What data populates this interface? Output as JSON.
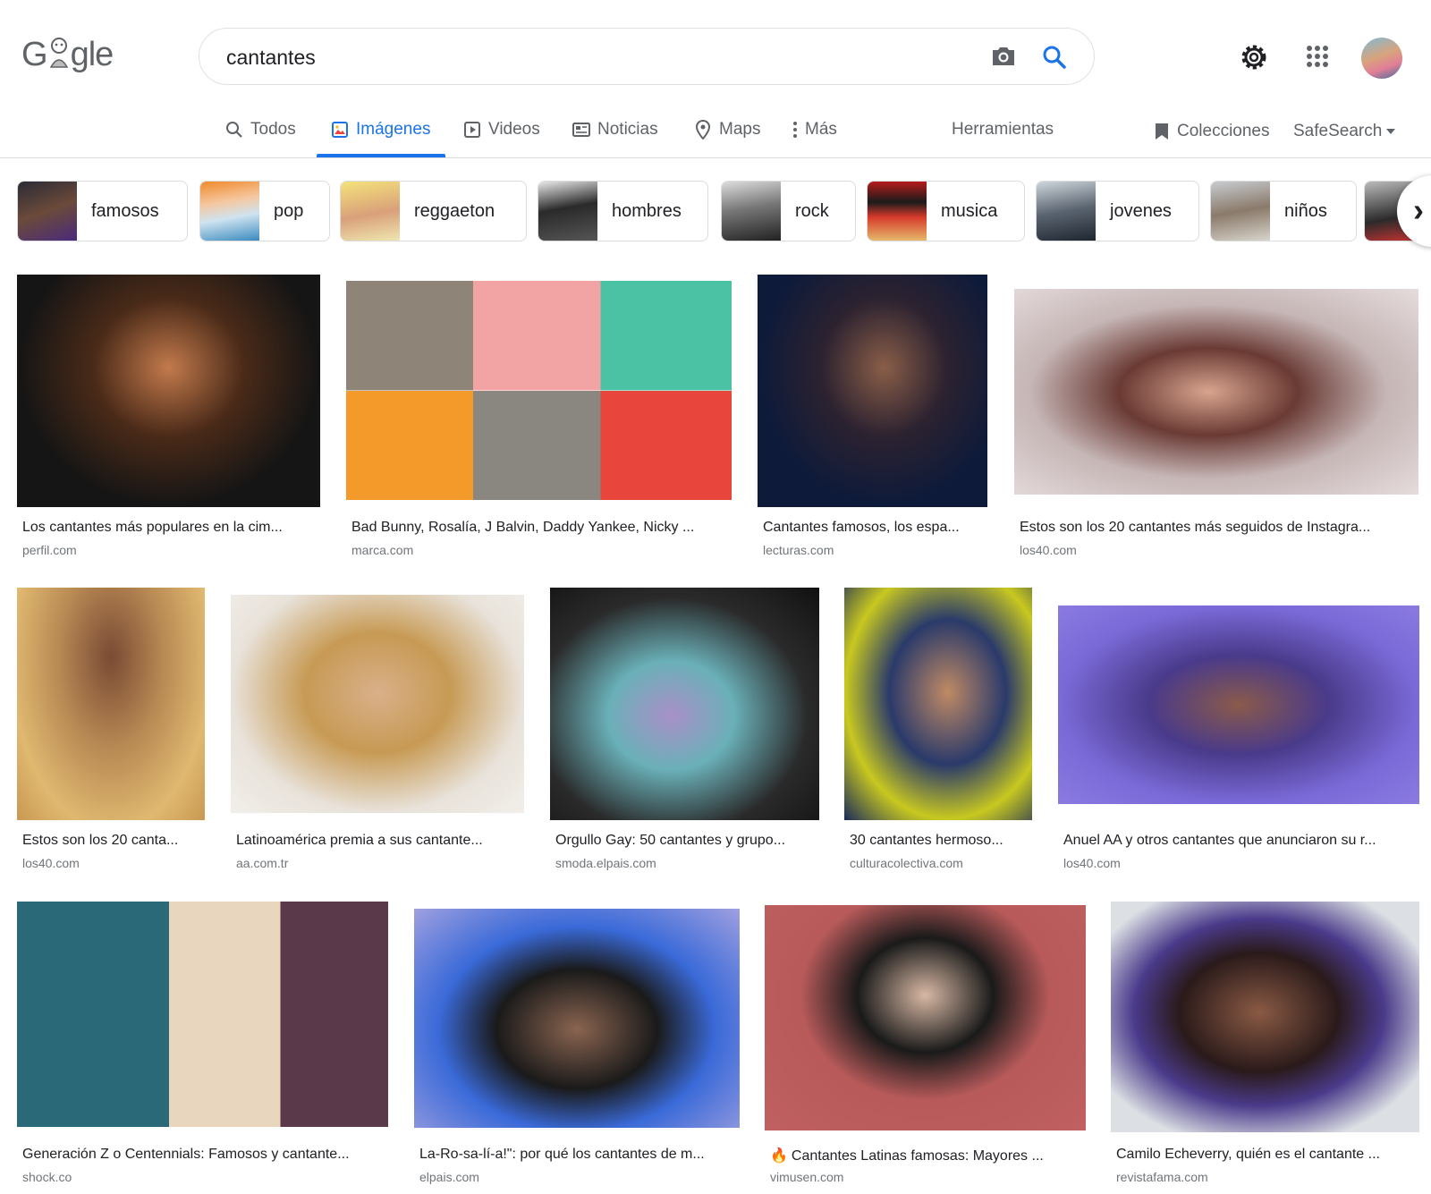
{
  "header": {
    "logo_text": "Gogle",
    "search_value": "cantantes"
  },
  "tabs": [
    {
      "label": "Todos",
      "icon": "search-icon"
    },
    {
      "label": "Imágenes",
      "icon": "image-icon",
      "active": true
    },
    {
      "label": "Videos",
      "icon": "play-icon"
    },
    {
      "label": "Noticias",
      "icon": "news-icon"
    },
    {
      "label": "Maps",
      "icon": "map-pin-icon"
    },
    {
      "label": "Más",
      "icon": "more-vert-icon"
    }
  ],
  "tools_label": "Herramientas",
  "collections_label": "Colecciones",
  "safesearch_label": "SafeSearch",
  "chips": [
    "famosos",
    "pop",
    "reggaeton",
    "hombres",
    "rock",
    "musica",
    "jovenes",
    "niños"
  ],
  "results": [
    {
      "title": "Los cantantes más populares en la cim...",
      "site": "perfil.com"
    },
    {
      "title": "Bad Bunny, Rosalía, J Balvin, Daddy Yankee, Nicky ...",
      "site": "marca.com"
    },
    {
      "title": "Cantantes famosos, los espa...",
      "site": "lecturas.com"
    },
    {
      "title": "Estos son los 20 cantantes más seguidos de Instagra...",
      "site": "los40.com"
    },
    {
      "title": "Estos son los 20 canta...",
      "site": "los40.com"
    },
    {
      "title": "Latinoamérica premia a sus cantante...",
      "site": "aa.com.tr"
    },
    {
      "title": "Orgullo Gay: 50 cantantes y grupo...",
      "site": "smoda.elpais.com"
    },
    {
      "title": "30 cantantes hermoso...",
      "site": "culturacolectiva.com"
    },
    {
      "title": "Anuel AA y otros cantantes que anunciaron su r...",
      "site": "los40.com"
    },
    {
      "title": "Generación Z o Centennials: Famosos y cantante...",
      "site": "shock.co"
    },
    {
      "title": "La-Ro-sa-lí-a!\": por qué los cantantes de m...",
      "site": "elpais.com"
    },
    {
      "title": "Cantantes Latinas famosas: Mayores ...",
      "site": "vimusen.com"
    },
    {
      "title": "Camilo Echeverry, quién es el cantante ...",
      "site": "revistafama.com"
    }
  ],
  "colors": {
    "accent": "#1a73e8",
    "text": "#202124",
    "muted": "#5f6368",
    "site": "#70757a",
    "border": "#dadce0"
  }
}
